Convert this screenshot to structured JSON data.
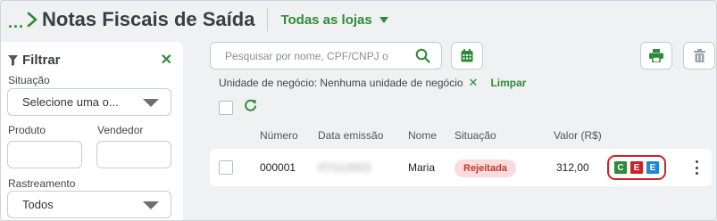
{
  "header": {
    "breadcrumb_dots": "...",
    "title": "Notas Fiscais de Saída",
    "store_selector": "Todas as lojas"
  },
  "filter": {
    "title": "Filtrar",
    "close_symbol": "✕",
    "situacao_label": "Situação",
    "situacao_value": "Selecione uma o...",
    "produto_label": "Produto",
    "vendedor_label": "Vendedor",
    "rastreamento_label": "Rastreamento",
    "rastreamento_value": "Todos"
  },
  "toolbar": {
    "search_placeholder": "Pesquisar por nome, CPF/CNPJ o",
    "chip_text": "Unidade de negócio: Nenhuma unidade de negócio",
    "chip_remove": "✕",
    "clear_label": "Limpar"
  },
  "table": {
    "columns": [
      "Número",
      "Data emissão",
      "Nome",
      "Situação",
      "Valor (R$)"
    ],
    "rows": [
      {
        "numero": "000001",
        "data_emissao": "07/11/2023",
        "nome": "Maria",
        "situacao": "Rejeitada",
        "valor": "312,00",
        "docs": [
          "C",
          "E",
          "E"
        ]
      }
    ]
  },
  "colors": {
    "accent_green": "#2e8b3a",
    "doc_c": "#2e8b3a",
    "doc_e1": "#d32027",
    "doc_e2": "#1e88d8",
    "highlight_red": "#d32027",
    "status_bg": "#fbdcdc",
    "status_fg": "#c0392b"
  },
  "icons": [
    "chevron-right-icon",
    "caret-down-icon",
    "funnel-icon",
    "close-icon",
    "search-icon",
    "calendar-icon",
    "printer-icon",
    "trash-icon",
    "refresh-icon",
    "kebab-menu-icon"
  ]
}
